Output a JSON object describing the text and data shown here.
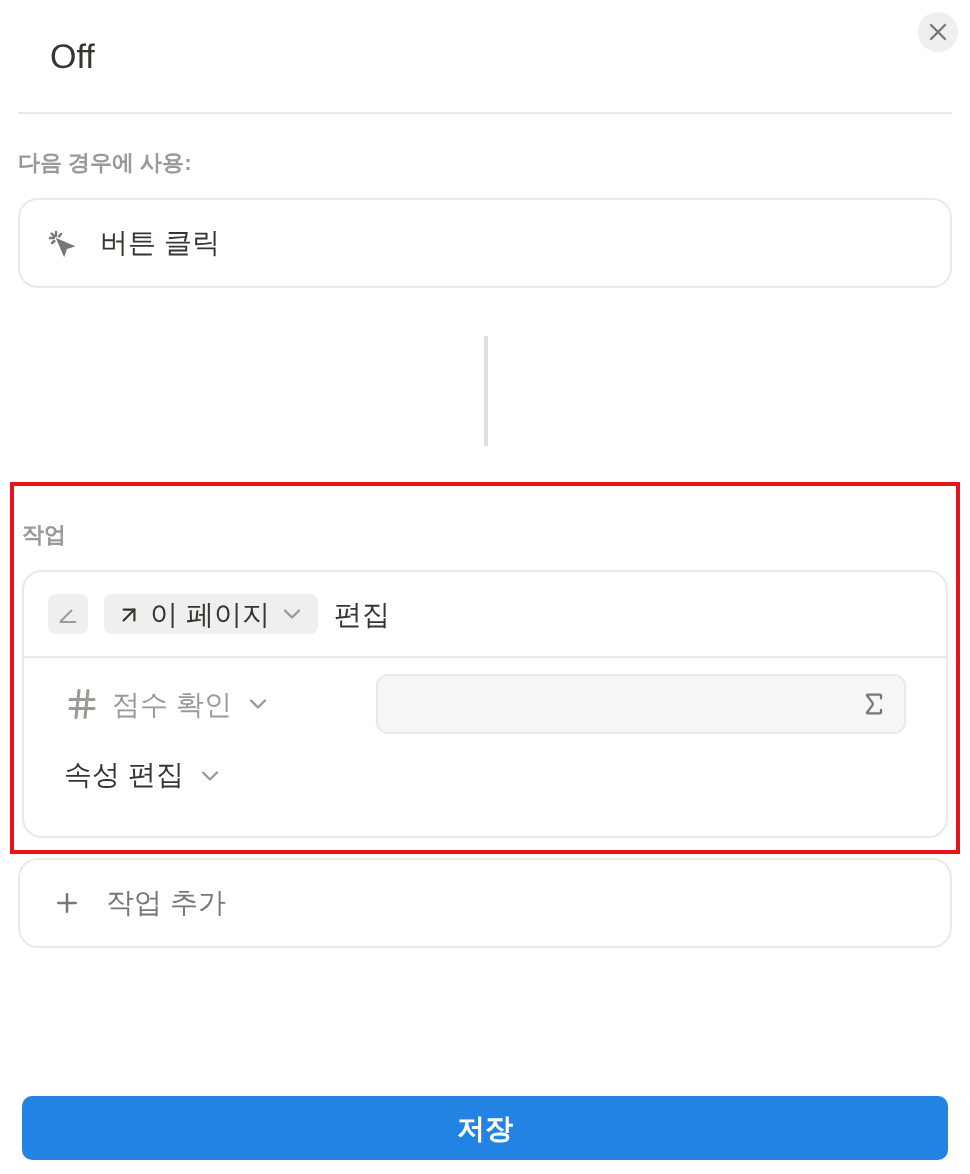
{
  "title": "Off",
  "trigger": {
    "label": "다음 경우에 사용:",
    "value": "버튼 클릭"
  },
  "actions": {
    "label": "작업",
    "highlighted": true,
    "action": {
      "page": "이 페이지",
      "verb": "편집",
      "property": "점수 확인",
      "edit_label": "속성 편집"
    }
  },
  "add_action": "작업 추가",
  "save": "저장"
}
